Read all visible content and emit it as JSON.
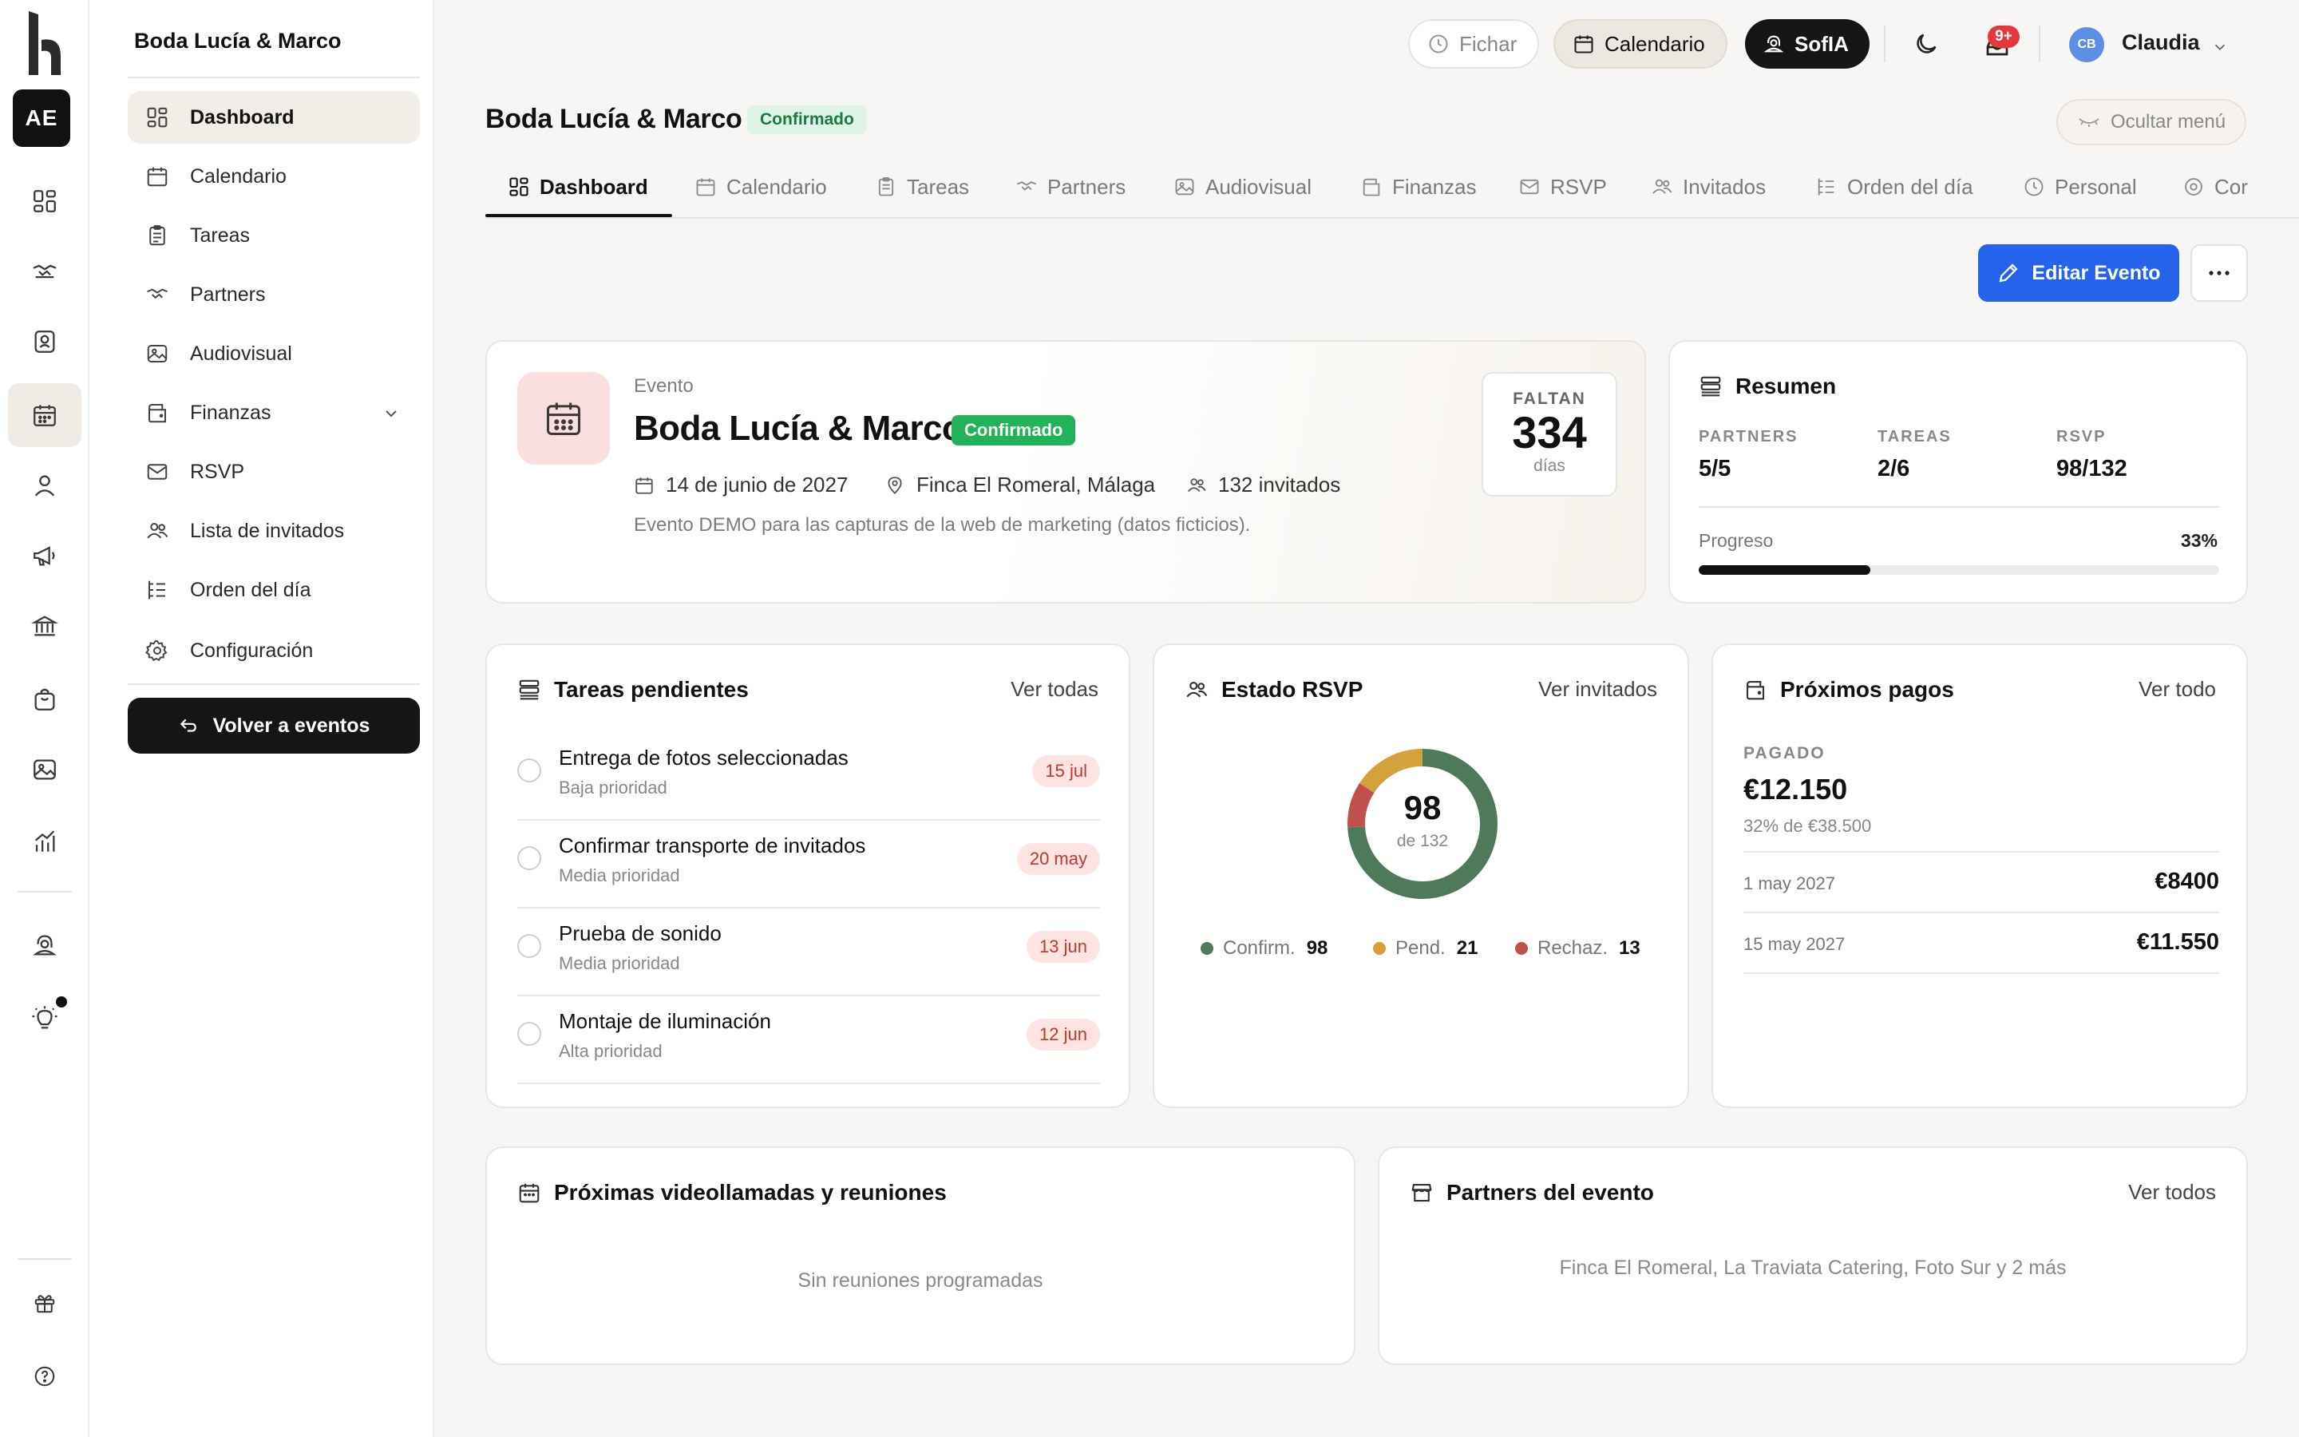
{
  "rail": {
    "org_initials": "AE",
    "icons": [
      "grid-icon",
      "handshake-icon",
      "contacts-icon",
      "calendar-icon",
      "user-icon",
      "megaphone-icon",
      "bank-icon",
      "bag-icon",
      "image-icon",
      "chart-icon",
      "support-icon",
      "bulb-icon",
      "gift-icon",
      "help-icon"
    ]
  },
  "sidebar": {
    "title": "Boda Lucía & Marco",
    "items": [
      {
        "label": "Dashboard",
        "icon": "grid-icon",
        "active": true
      },
      {
        "label": "Calendario",
        "icon": "calendar-icon"
      },
      {
        "label": "Tareas",
        "icon": "clipboard-icon"
      },
      {
        "label": "Partners",
        "icon": "handshake-icon"
      },
      {
        "label": "Audiovisual",
        "icon": "image-icon"
      },
      {
        "label": "Finanzas",
        "icon": "wallet-icon",
        "has_submenu": true
      },
      {
        "label": "RSVP",
        "icon": "mail-icon"
      },
      {
        "label": "Lista de invitados",
        "icon": "users-icon"
      },
      {
        "label": "Orden del día",
        "icon": "list-icon"
      },
      {
        "label": "Configuración",
        "icon": "gear-icon"
      }
    ],
    "back_label": "Volver a eventos"
  },
  "header": {
    "fichar": "Fichar",
    "calendario": "Calendario",
    "sofia": "SofIA",
    "notifications_badge": "9+",
    "avatar_initials": "CB",
    "user_name": "Claudia"
  },
  "page": {
    "title": "Boda Lucía & Marco",
    "status": "Confirmado",
    "hide_menu": "Ocultar menú"
  },
  "tabs": [
    {
      "label": "Dashboard",
      "icon": "grid-icon",
      "active": true
    },
    {
      "label": "Calendario",
      "icon": "calendar-icon"
    },
    {
      "label": "Tareas",
      "icon": "clipboard-icon"
    },
    {
      "label": "Partners",
      "icon": "handshake-icon"
    },
    {
      "label": "Audiovisual",
      "icon": "image-icon"
    },
    {
      "label": "Finanzas",
      "icon": "wallet-icon"
    },
    {
      "label": "RSVP",
      "icon": "mail-icon"
    },
    {
      "label": "Invitados",
      "icon": "users-icon"
    },
    {
      "label": "Orden del día",
      "icon": "list-icon"
    },
    {
      "label": "Personal",
      "icon": "clock-icon"
    },
    {
      "label": "Cor",
      "icon": "gear-icon"
    }
  ],
  "actions": {
    "edit": "Editar Evento",
    "more": "···"
  },
  "event": {
    "label": "Evento",
    "name": "Boda Lucía & Marco",
    "status": "Confirmado",
    "date": "14 de junio de 2027",
    "venue": "Finca El Romeral, Málaga",
    "guests": "132 invitados",
    "description": "Evento DEMO para las capturas de la web de marketing (datos ficticios).",
    "countdown_label": "FALTAN",
    "countdown_value": "334",
    "countdown_unit": "días"
  },
  "summary": {
    "title": "Resumen",
    "stats": [
      {
        "label": "PARTNERS",
        "value": "5/5"
      },
      {
        "label": "TAREAS",
        "value": "2/6"
      },
      {
        "label": "RSVP",
        "value": "98/132"
      }
    ],
    "progress_label": "Progreso",
    "progress_text": "33%",
    "progress_value": 0.33
  },
  "tasks": {
    "title": "Tareas pendientes",
    "link": "Ver todas",
    "items": [
      {
        "title": "Entrega de fotos seleccionadas",
        "priority": "Baja prioridad",
        "date": "15 jul"
      },
      {
        "title": "Confirmar transporte de invitados",
        "priority": "Media prioridad",
        "date": "20 may"
      },
      {
        "title": "Prueba de sonido",
        "priority": "Media prioridad",
        "date": "13 jun"
      },
      {
        "title": "Montaje de iluminación",
        "priority": "Alta prioridad",
        "date": "12 jun"
      }
    ]
  },
  "rsvp": {
    "title": "Estado RSVP",
    "link": "Ver invitados",
    "center_value": "98",
    "center_sub": "de 132",
    "segments": [
      {
        "label": "Confirm.",
        "value": 98,
        "color": "#4e7a5a"
      },
      {
        "label": "Pend.",
        "value": 21,
        "color": "#d4a23a"
      },
      {
        "label": "Rechaz.",
        "value": 13,
        "color": "#c0504d"
      }
    ],
    "legend_values": [
      "98",
      "21",
      "13"
    ]
  },
  "payments": {
    "title": "Próximos pagos",
    "link": "Ver todo",
    "paid_label": "PAGADO",
    "paid_amount": "€12.150",
    "paid_sub": "32% de €38.500",
    "rows": [
      {
        "date": "1 may 2027",
        "amount": "€8400"
      },
      {
        "date": "15 may 2027",
        "amount": "€11.550"
      }
    ]
  },
  "meetings": {
    "title": "Próximas videollamadas y reuniones",
    "empty": "Sin reuniones programadas"
  },
  "partners": {
    "title": "Partners del evento",
    "link": "Ver todos",
    "summary": "Finca El Romeral, La Traviata Catering, Foto Sur y 2 más"
  }
}
